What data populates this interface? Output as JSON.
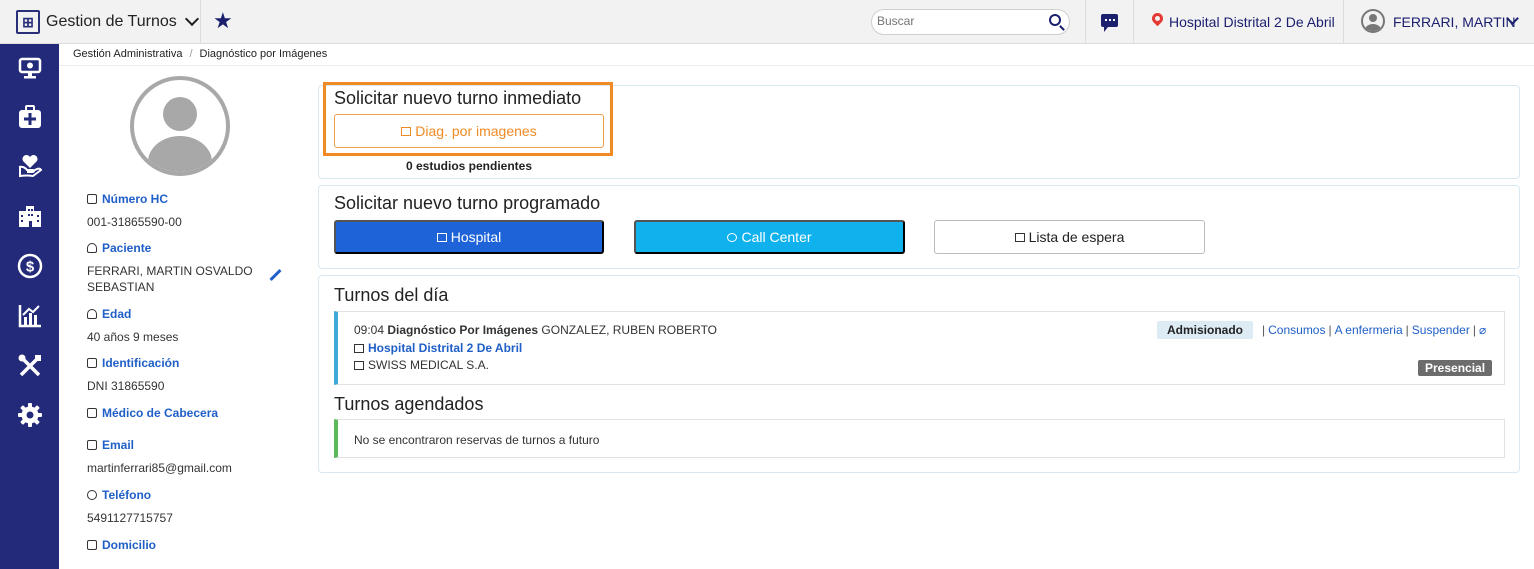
{
  "topbar": {
    "app_title": "Gestion de Turnos",
    "search_placeholder": "Buscar",
    "hospital": "Hospital Distrital 2 De Abril",
    "user": "FERRARI, MARTIN"
  },
  "breadcrumb": [
    "Gestión Administrativa",
    "Diagnóstico por Imágenes"
  ],
  "sidebar": {
    "icons": [
      "monitor-icon",
      "first-aid-kit-icon",
      "hand-heart-icon",
      "building-icon",
      "dollar-icon",
      "chart-icon",
      "tools-icon",
      "gear-icon"
    ]
  },
  "patient": {
    "hc_label": "Número HC",
    "hc_value": "001-31865590-00",
    "patient_label": "Paciente",
    "patient_value": "FERRARI, MARTIN OSVALDO SEBASTIAN",
    "age_label": "Edad",
    "age_value": "40 años 9 meses",
    "id_label": "Identificación",
    "id_value": "DNI 31865590",
    "doctor_label": "Médico de Cabecera",
    "email_label": "Email",
    "email_value": "martinferrari85@gmail.com",
    "phone_label": "Teléfono",
    "phone_value": "5491127715757",
    "address_label": "Domicilio"
  },
  "immediate": {
    "title": "Solicitar nuevo turno inmediato",
    "button": "Diag. por imagenes",
    "pending": "0 estudios pendientes"
  },
  "scheduled": {
    "title": "Solicitar nuevo turno programado",
    "hospital_button": "Hospital",
    "callcenter_button": "Call Center",
    "waitlist_button": "Lista de espera"
  },
  "today": {
    "title": "Turnos del día",
    "time": "09:04",
    "service": "Diagnóstico Por Imágenes",
    "doctor": "GONZALEZ, RUBEN ROBERTO",
    "location": "Hospital Distrital 2 De Abril",
    "insurance": "SWISS MEDICAL S.A.",
    "status": "Admisionado",
    "actions": [
      "Consumos",
      "A enfermeria",
      "Suspender"
    ],
    "modality": "Presencial"
  },
  "future": {
    "title": "Turnos agendados",
    "empty": "No se encontraron reservas de turnos a futuro"
  },
  "colors": {
    "sidebar": "#232a7a",
    "primary": "#1e64d8",
    "call_center": "#10b2ee",
    "highlight": "#f08a24",
    "link": "#1f5fc7"
  }
}
